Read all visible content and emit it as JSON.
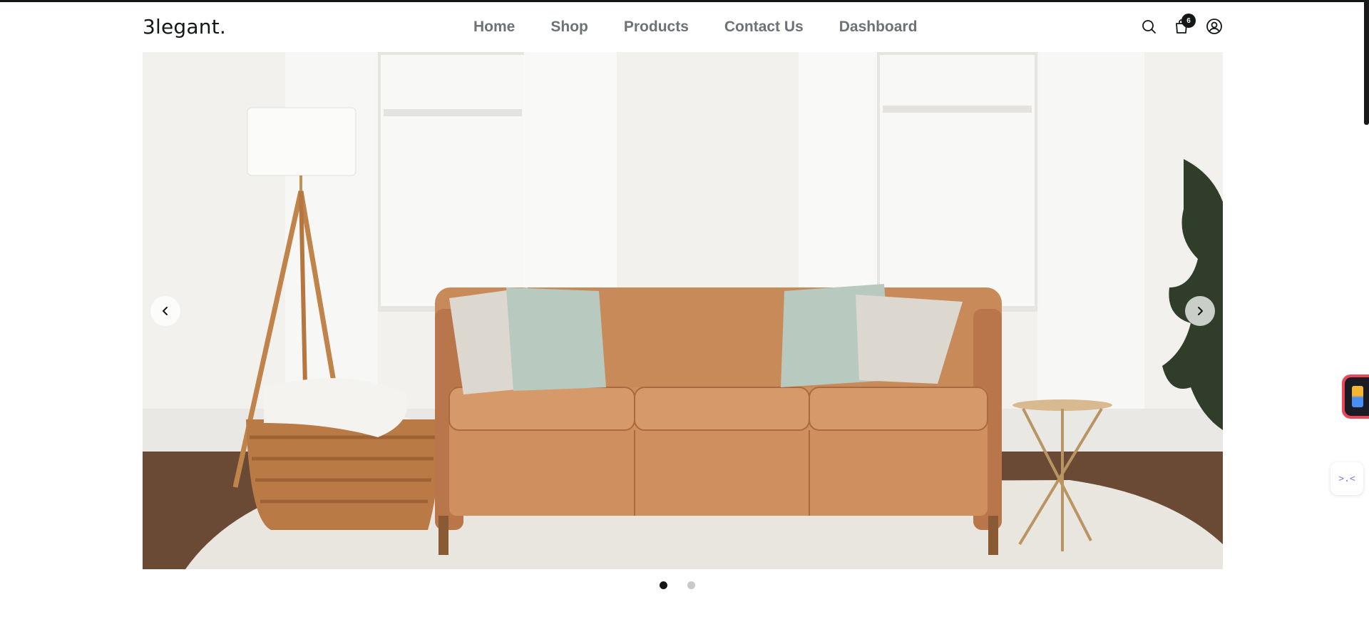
{
  "brand": {
    "logo_text": "3legant",
    "logo_dot": "."
  },
  "nav": {
    "items": [
      {
        "label": "Home"
      },
      {
        "label": "Shop"
      },
      {
        "label": "Products"
      },
      {
        "label": "Contact Us"
      },
      {
        "label": "Dashboard"
      }
    ]
  },
  "header_icons": {
    "search": "search-icon",
    "cart": "shopping-bag-icon",
    "cart_count": "6",
    "account": "user-circle-icon"
  },
  "hero": {
    "slide_count": 2,
    "active_slide": 1,
    "prev_icon": "chevron-left-icon",
    "next_icon": "chevron-right-icon"
  },
  "side_widgets": {
    "extension_icon": "extension-app-icon",
    "floating_icon": "code-tool-icon",
    "floating_label": ">.<"
  },
  "colors": {
    "text_dark": "#141718",
    "nav_text": "#6c7275",
    "sofa": "#c98a5a",
    "pillow_green": "#b8c9bf",
    "pillow_beige": "#dcd7cf"
  }
}
